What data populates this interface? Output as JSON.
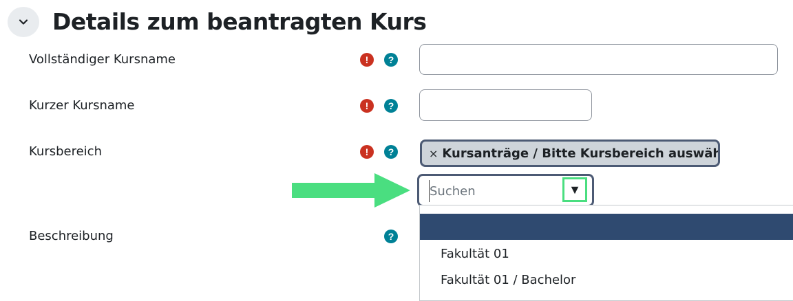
{
  "section": {
    "title": "Details zum beantragten Kurs"
  },
  "fields": {
    "fullname": {
      "label": "Vollständiger Kursname",
      "value": ""
    },
    "shortname": {
      "label": "Kurzer Kursname",
      "value": ""
    },
    "category": {
      "label": "Kursbereich",
      "selected_tag": "Kursanträge / Bitte Kursbereich auswählen ...",
      "remove_symbol": "×",
      "search_placeholder": "Suchen",
      "toggle_symbol": "▼",
      "options": [
        "",
        "Fakultät 01",
        "Fakultät 01 / Bachelor"
      ]
    },
    "description": {
      "label": "Beschreibung"
    }
  },
  "icons": {
    "required": "!",
    "help": "?"
  },
  "colors": {
    "required_icon": "#ca3120",
    "help_icon": "#008196",
    "highlight_option": "#2f4a70",
    "arrow": "#4ade80",
    "toggle_border": "#4ade80"
  }
}
